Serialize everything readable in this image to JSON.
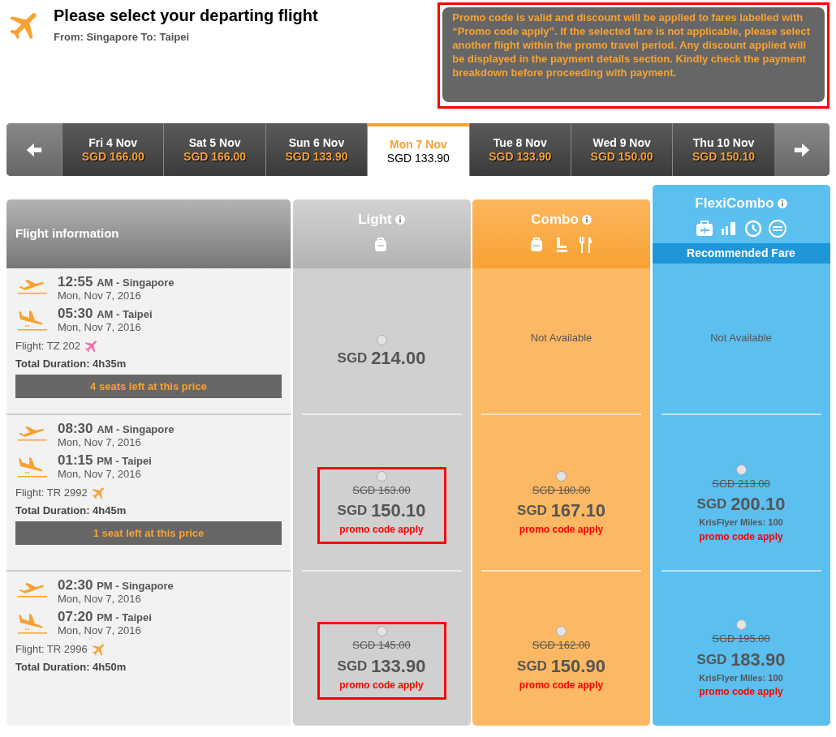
{
  "header": {
    "title": "Please select your departing flight",
    "route": "From: Singapore To: Taipei"
  },
  "promo_notice": {
    "text": "Promo code is valid and discount will be applied to fares labelled with “Promo code apply”. If the selected fare is not applicable, please select another flight within the promo travel period. Any discount applied will be displayed in the payment details section. Kindly check the payment breakdown before proceeding with payment.",
    "highlighted": true
  },
  "date_tabs": [
    {
      "day": "Fri 4 Nov",
      "price": "SGD 166.00",
      "selected": false
    },
    {
      "day": "Sat 5 Nov",
      "price": "SGD 166.00",
      "selected": false
    },
    {
      "day": "Sun 6 Nov",
      "price": "SGD 133.90",
      "selected": false
    },
    {
      "day": "Mon 7 Nov",
      "price": "SGD 133.90",
      "selected": true
    },
    {
      "day": "Tue 8 Nov",
      "price": "SGD 133.90",
      "selected": false
    },
    {
      "day": "Wed 9 Nov",
      "price": "SGD 150.00",
      "selected": false
    },
    {
      "day": "Thu 10 Nov",
      "price": "SGD 150.10",
      "selected": false
    }
  ],
  "info_column": {
    "title": "Flight information"
  },
  "fare_columns": [
    {
      "name": "Light",
      "kind": "light"
    },
    {
      "name": "Combo",
      "kind": "combo"
    },
    {
      "name": "FlexiCombo",
      "kind": "flexi",
      "banner": "Recommended Fare"
    }
  ],
  "flights": [
    {
      "depart": {
        "time": "12:55",
        "label": "AM - Singapore",
        "date": "Mon, Nov 7, 2016"
      },
      "arrive": {
        "time": "05:30",
        "label": "AM - Taipei",
        "date": "Mon, Nov 7, 2016"
      },
      "flight": "Flight: TZ 202",
      "color": "#f06fae",
      "duration": "Total Duration: 4h35m",
      "seats": "4 seats left at this price",
      "fares": [
        {
          "available": true,
          "selected": false,
          "highlighted": false,
          "currency": "SGD",
          "amount": "214.00"
        },
        {
          "available": false,
          "text": "Not Available"
        },
        {
          "available": false,
          "text": "Not Available"
        }
      ]
    },
    {
      "depart": {
        "time": "08:30",
        "label": "AM - Singapore",
        "date": "Mon, Nov 7, 2016"
      },
      "arrive": {
        "time": "01:15",
        "label": "PM - Taipei",
        "date": "Mon, Nov 7, 2016"
      },
      "flight": "Flight: TR 2992",
      "color": "#f7a233",
      "duration": "Total Duration: 4h45m",
      "seats": "1 seat left at this price",
      "fares": [
        {
          "available": true,
          "selected": false,
          "highlighted": true,
          "original": "SGD 163.00",
          "currency": "SGD",
          "amount": "150.10",
          "promo": "promo code apply"
        },
        {
          "available": true,
          "selected": false,
          "highlighted": false,
          "original": "SGD 180.00",
          "currency": "SGD",
          "amount": "167.10",
          "promo": "promo code apply"
        },
        {
          "available": true,
          "selected": false,
          "highlighted": false,
          "original": "SGD 213.00",
          "currency": "SGD",
          "amount": "200.10",
          "miles": "KrisFlyer Miles: 100",
          "promo": "promo code apply"
        }
      ]
    },
    {
      "depart": {
        "time": "02:30",
        "label": "PM - Singapore",
        "date": "Mon, Nov 7, 2016"
      },
      "arrive": {
        "time": "07:20",
        "label": "PM - Taipei",
        "date": "Mon, Nov 7, 2016"
      },
      "flight": "Flight: TR 2996",
      "color": "#f7a233",
      "duration": "Total Duration: 4h50m",
      "fares": [
        {
          "available": true,
          "selected": false,
          "highlighted": true,
          "original": "SGD 145.00",
          "currency": "SGD",
          "amount": "133.90",
          "promo": "promo code apply"
        },
        {
          "available": true,
          "selected": false,
          "highlighted": false,
          "original": "SGD 162.00",
          "currency": "SGD",
          "amount": "150.90",
          "promo": "promo code apply"
        },
        {
          "available": true,
          "selected": false,
          "highlighted": false,
          "original": "SGD 195.00",
          "currency": "SGD",
          "amount": "183.90",
          "miles": "KrisFlyer Miles: 100",
          "promo": "promo code apply"
        }
      ]
    }
  ]
}
